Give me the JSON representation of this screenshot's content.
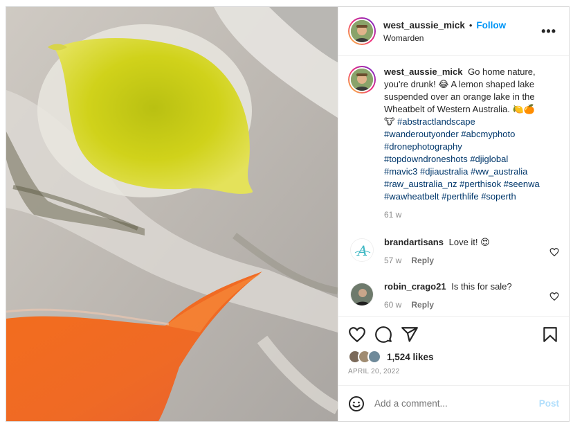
{
  "post": {
    "author": {
      "username": "west_aussie_mick",
      "location": "Womarden",
      "follow_label": "Follow",
      "separator": "•"
    },
    "caption": {
      "text": "Go home nature, you're drunk! 😂 A lemon shaped lake suspended over an orange lake in the Wheatbelt of Western Australia. 🍋🍊 🐮",
      "hashtags": "#abstractlandscape #wanderoutyonder #abcmyphoto #dronephotography #topdowndroneshots #djiglobal #mavic3 #djiaustralia #ww_australia #raw_australia_nz #perthisok #seenwa #wawheatbelt #perthlife #soperth",
      "age": "61 w"
    },
    "comments": [
      {
        "username": "brandartisans",
        "text": "Love it! 😍",
        "age": "57 w",
        "reply_label": "Reply"
      },
      {
        "username": "robin_crago21",
        "text": "Is this for sale?",
        "age": "60 w",
        "reply_label": "Reply"
      }
    ],
    "likes": "1,524 likes",
    "date": "APRIL 20, 2022",
    "add_comment_placeholder": "Add a comment...",
    "post_label": "Post"
  },
  "colors": {
    "link": "#0095f6",
    "hashtag": "#00376b",
    "lemon_lake": "#d2d11d",
    "orange_lake": "#f06a1f"
  },
  "icons": [
    "more-icon",
    "heart-icon",
    "comment-icon",
    "share-icon",
    "bookmark-icon",
    "emoji-icon"
  ]
}
